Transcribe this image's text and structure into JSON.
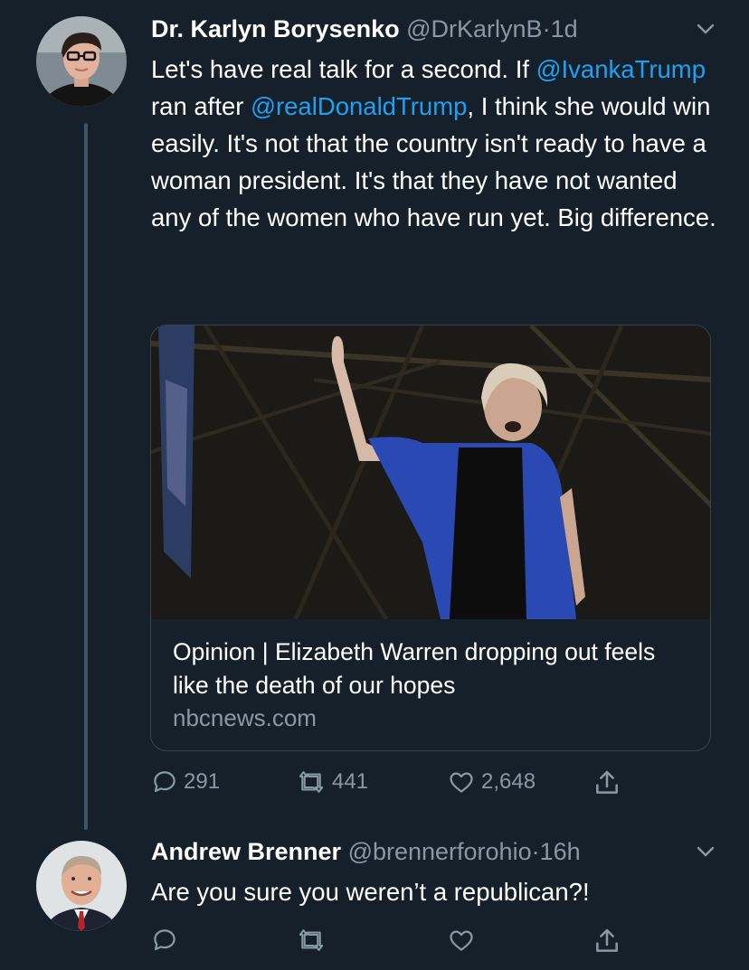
{
  "tweets": [
    {
      "name": "Dr. Karlyn Borysenko",
      "handle": "@DrKarlynB",
      "separator": "·",
      "time": "1d",
      "text_parts": {
        "p1": "Let's have real talk for a second. If ",
        "mention1": "@IvankaTrump",
        "p2": " ran after ",
        "mention2": "@realDonaldTrump",
        "p3": ", I think she would win easily. It's not that the country isn't ready to have a woman president. It's that they have not wanted any of the women who have run yet. Big difference."
      },
      "card": {
        "title": "Opinion | Elizabeth Warren dropping out feels like the death of our hopes",
        "domain": "nbcnews.com"
      },
      "actions": {
        "replies": "291",
        "retweets": "441",
        "likes": "2,648"
      }
    },
    {
      "name": "Andrew Brenner",
      "handle": "@brennerforohio",
      "separator": "·",
      "time": "16h",
      "text": "Are you sure you weren’t a republican?!"
    }
  ],
  "colors": {
    "background": "#15202b",
    "accent": "#1da1f2",
    "muted": "#8899a6",
    "border": "#38444d"
  },
  "icons": [
    "avatar",
    "chevron-down-icon",
    "reply-icon",
    "retweet-icon",
    "like-icon",
    "share-icon"
  ]
}
